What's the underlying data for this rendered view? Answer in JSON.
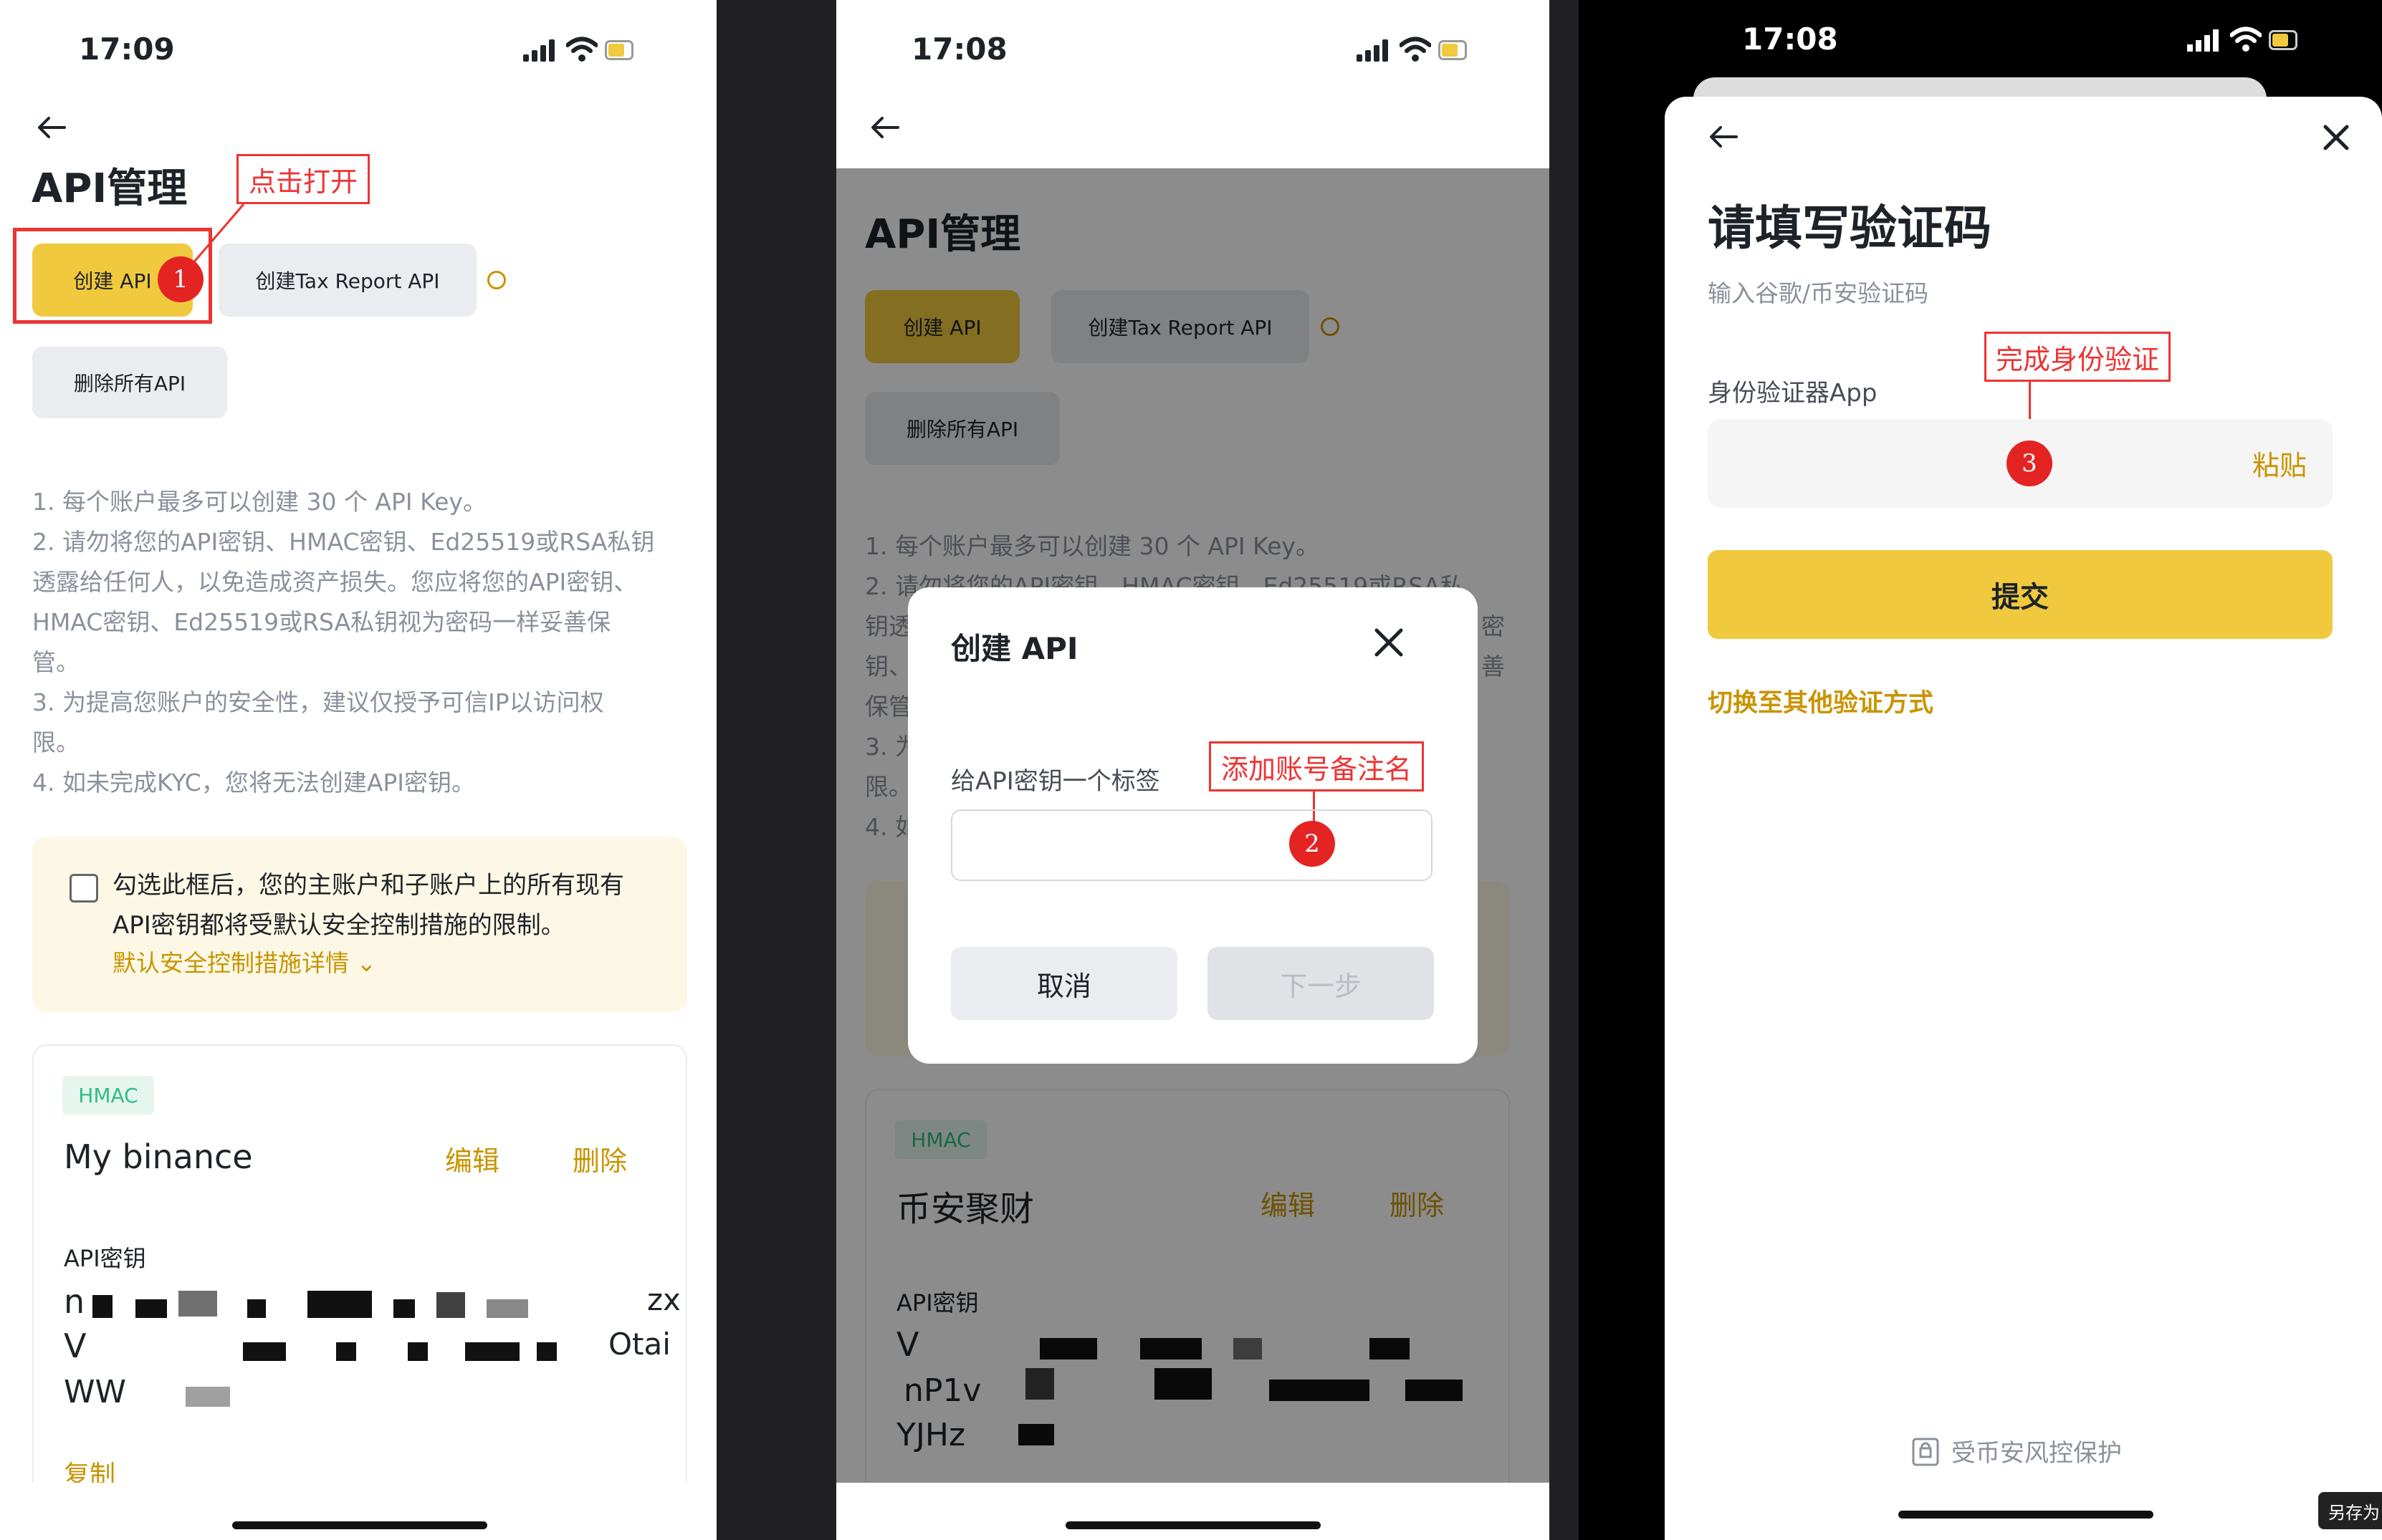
{
  "phone1": {
    "time": "17:09",
    "title": "API管理",
    "annotation_label": "点击打开",
    "annotation_step": "1",
    "create_api": "创建 API",
    "create_tax_api": "创建Tax Report API",
    "delete_all_api": "删除所有API",
    "notes": [
      "1. 每个账户最多可以创建 30 个 API Key。",
      "2. 请勿将您的API密钥、HMAC密钥、Ed25519或RSA私钥",
      "透露给任何人，以免造成资产损失。您应将您的API密钥、",
      "HMAC密钥、Ed25519或RSA私钥视为密码一样妥善保",
      "管。",
      "3. 为提高您账户的安全性，建议仅授予可信IP以访问权",
      "限。",
      "4. 如未完成KYC，您将无法创建API密钥。"
    ],
    "checkbox_line1": "勾选此框后，您的主账户和子账户上的所有现有",
    "checkbox_line2": "API密钥都将受默认安全控制措施的限制。",
    "checkbox_link": "默认安全控制措施详情 ⌄",
    "card_tag": "HMAC",
    "card_name": "My binance",
    "edit": "编辑",
    "delete": "删除",
    "api_key_label": "API密钥",
    "key_fragments": [
      "n",
      "zx",
      "V",
      "Otai",
      "WW"
    ],
    "copy": "复制"
  },
  "phone2": {
    "time": "17:08",
    "title": "API管理",
    "create_api": "创建 API",
    "create_tax_api": "创建Tax Report API",
    "delete_all_api": "删除所有API",
    "notes": [
      "1. 每个账户最多可以创建 30 个 API Key。",
      "2. 请勿将您的API密钥、HMAC密钥、Ed25519或RSA私",
      "钥透",
      "钥、",
      "保管",
      "3. 为",
      "限。",
      "4. 如"
    ],
    "notes_right": [
      "密",
      "善"
    ],
    "card_tag": "HMAC",
    "card_name": "币安聚财",
    "edit": "编辑",
    "delete": "删除",
    "api_key_label": "API密钥",
    "key_fragments": [
      "V",
      "nP1v",
      "YJHz"
    ],
    "modal": {
      "title": "创建 API",
      "field_label": "给API密钥一个标签",
      "cancel": "取消",
      "next": "下一步",
      "annotation_label": "添加账号备注名",
      "annotation_step": "2"
    }
  },
  "phone3": {
    "time": "17:08",
    "title": "请填写验证码",
    "subtitle": "输入谷歌/币安验证码",
    "annotation_label": "完成身份验证",
    "annotation_step": "3",
    "field_label": "身份验证器App",
    "paste": "粘贴",
    "submit": "提交",
    "switch_method": "切换至其他验证方式",
    "protected": "受币安风控保护",
    "save_as": "另存为"
  },
  "colors": {
    "brand_yellow": "#f0c93e",
    "gold_text": "#c99400",
    "annotation_red": "#e33333",
    "hmac_tag_bg": "#e6f6ef",
    "hmac_tag_text": "#2ebd85"
  }
}
